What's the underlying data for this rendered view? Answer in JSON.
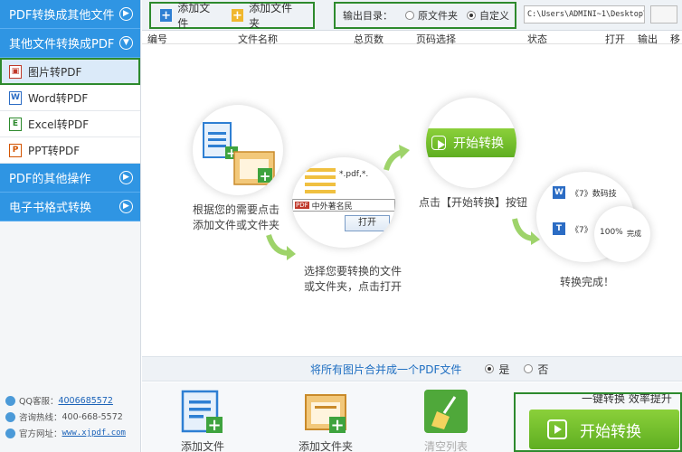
{
  "sidebar": {
    "categories": [
      {
        "label": "PDF转换成其他文件",
        "icon": "chevron-right-icon"
      },
      {
        "label": "其他文件转换成PDF",
        "icon": "chevron-down-icon"
      }
    ],
    "items": [
      {
        "label": "图片转PDF",
        "active": true
      },
      {
        "label": "Word转PDF",
        "active": false
      },
      {
        "label": "Excel转PDF",
        "active": false
      },
      {
        "label": "PPT转PDF",
        "active": false
      }
    ],
    "bottom_categories": [
      {
        "label": "PDF的其他操作"
      },
      {
        "label": "电子书格式转换"
      }
    ],
    "contact": {
      "qq_label": "QQ客服：",
      "qq_value": "4006685572",
      "phone_label": "咨询热线：",
      "phone_value": "400-668-5572",
      "site_label": "官方网址：",
      "site_value": "www.xjpdf.com"
    }
  },
  "toolbar": {
    "add_file": "添加文件",
    "add_folder": "添加文件夹",
    "output_label": "输出目录：",
    "opt_original": "原文件夹",
    "opt_custom": "自定义",
    "path": "C:\\Users\\ADMINI~1\\Desktop\\"
  },
  "table": {
    "columns": [
      "编号",
      "文件名称",
      "总页数",
      "页码选择",
      "状态",
      "打开",
      "输出",
      "移"
    ]
  },
  "steps": {
    "step1": "根据您的需要点击\n添加文件或文件夹",
    "step2": "选择您要转换的文件\n或文件夹，点击打开",
    "step3": "点击【开始转换】按钮",
    "step4": "转换完成！",
    "thumb_start": "开始转换",
    "thumb_open": "打开",
    "thumb_file": "中外著名民",
    "thumb_ext": "*.pdf,*.",
    "thumb_doc1": "《7》数码技",
    "thumb_doc2": "《7》",
    "thumb_progress": "100%",
    "thumb_done": "完成"
  },
  "merge": {
    "label": "将所有图片合并成一个PDF文件",
    "yes": "是",
    "no": "否"
  },
  "bottom": {
    "add_file": "添加文件",
    "add_folder": "添加文件夹",
    "clear": "清空列表",
    "slogan": "一键转换  效率提升",
    "start": "开始转换"
  }
}
